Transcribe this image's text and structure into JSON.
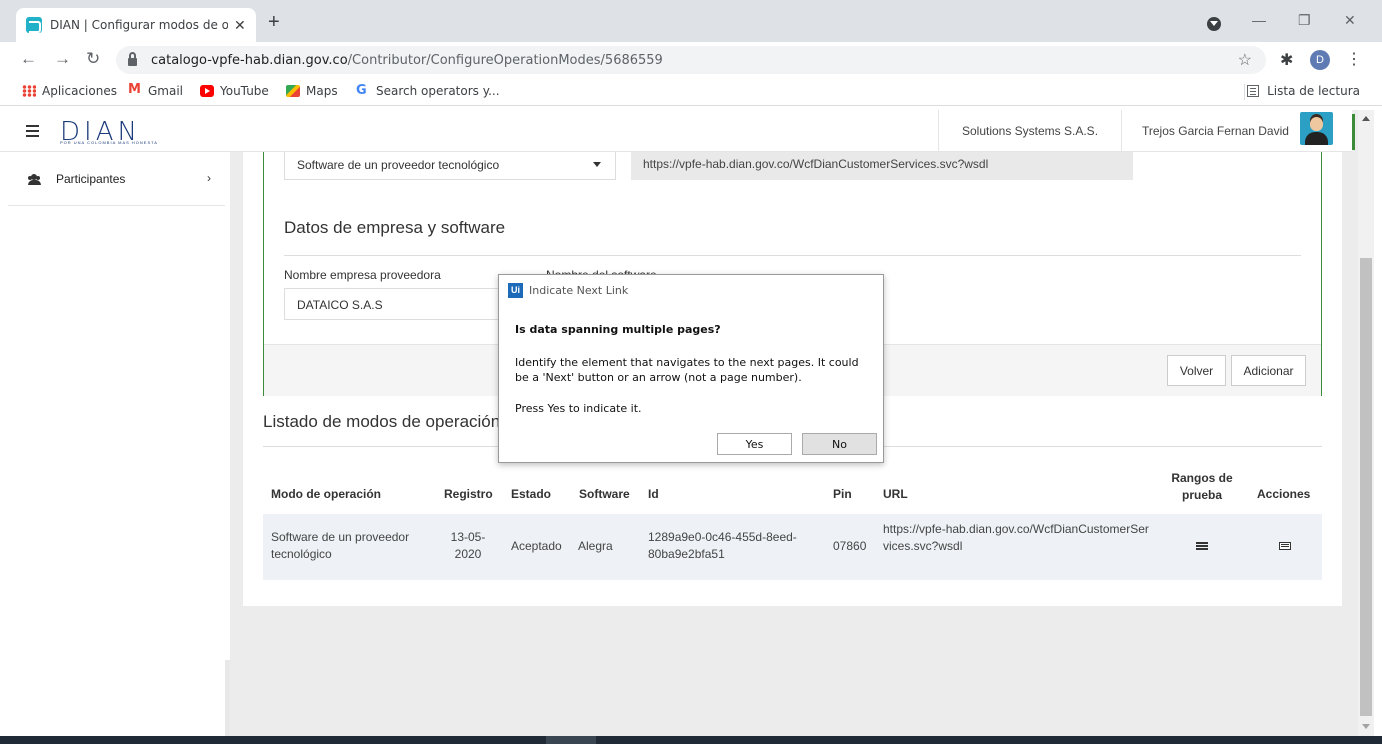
{
  "browser": {
    "tab_title": "DIAN | Configurar modos de ope",
    "tab_close": "✕",
    "new_tab": "+",
    "url_host": "catalogo-vpfe-hab.dian.gov.co",
    "url_path": "/Contributor/ConfigureOperationModes/5686559",
    "profile_initial": "D",
    "bookmarks": [
      "Aplicaciones",
      "Gmail",
      "YouTube",
      "Maps",
      "Search operators y..."
    ],
    "reading_list": "Lista de lectura"
  },
  "header": {
    "logo": "DIAN",
    "logo_sub": "POR UNA COLOMBIA MAS HONESTA",
    "company": "Solutions Systems S.A.S.",
    "user": "Trejos Garcia Fernan David"
  },
  "sidebar": {
    "items": [
      {
        "label": "Participantes"
      }
    ]
  },
  "form": {
    "mode_select": "Software de un proveedor tecnológico",
    "wsdl_url": "https://vpfe-hab.dian.gov.co/WcfDianCustomerServices.svc?wsdl",
    "section_title": "Datos de empresa y software",
    "label_empresa": "Nombre empresa proveedora",
    "label_software": "Nombre del software",
    "empresa_value": "DATAICO S.A.S",
    "btn_volver": "Volver",
    "btn_adicionar": "Adicionar"
  },
  "list": {
    "title": "Listado de modos de operación",
    "columns": [
      "Modo de operación",
      "Registro",
      "Estado",
      "Software",
      "Id",
      "Pin",
      "URL",
      "Rangos de prueba",
      "Acciones"
    ],
    "rows": [
      {
        "modo": "Software de un proveedor tecnológico",
        "registro": "13-05-2020",
        "estado": "Aceptado",
        "software": "Alegra",
        "id": "1289a9e0-0c46-455d-8eed-80ba9e2bfa51",
        "pin": "07860",
        "url": "https://vpfe-hab.dian.gov.co/WcfDianCustomerServices.svc?wsdl"
      }
    ]
  },
  "dialog": {
    "logo": "Ui",
    "title": "Indicate Next Link",
    "question": "Is data spanning multiple pages?",
    "description": "Identify the element that navigates to the next pages. It could be a 'Next' button or an arrow (not a page number).",
    "prompt": "Press Yes to indicate it.",
    "yes_label": "Yes",
    "no_label": "No"
  },
  "icons": {
    "back": "←",
    "forward": "→",
    "reload": "↻",
    "star": "☆",
    "extensions": "✱",
    "menu": "⋮",
    "chevron": "›"
  }
}
